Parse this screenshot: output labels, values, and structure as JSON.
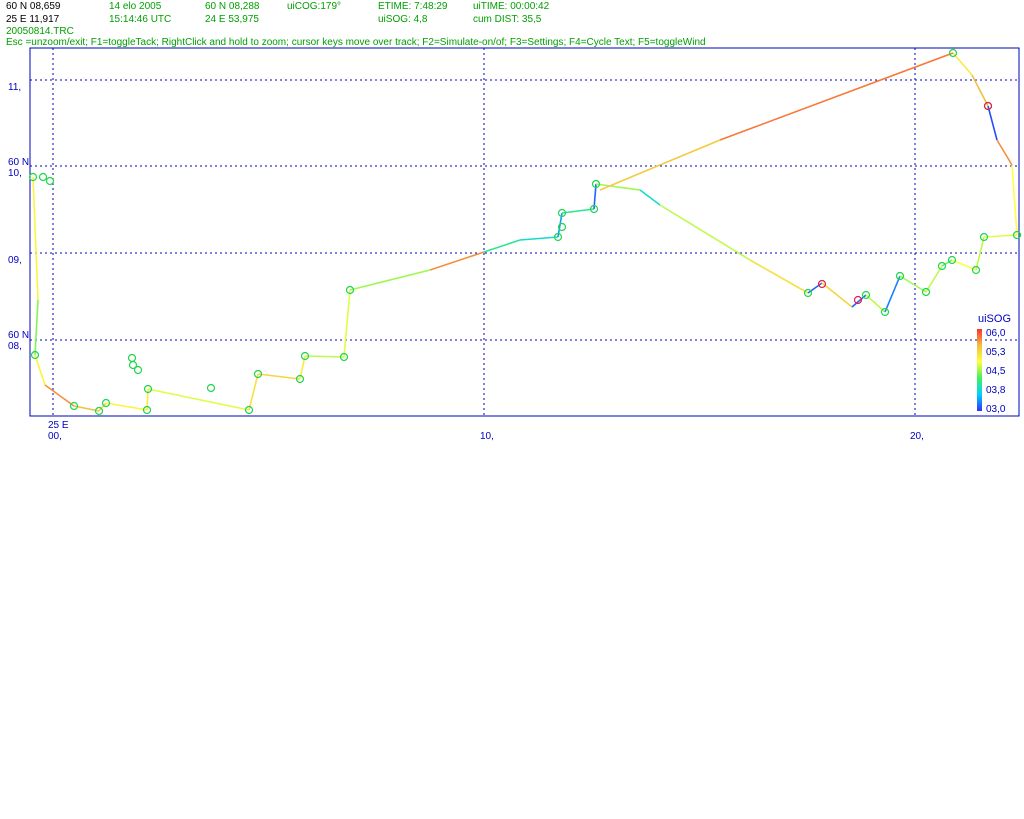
{
  "header": {
    "lat_cursor": "60 N 08,659",
    "lon_cursor": "25 E 11,917",
    "date": "14 elo 2005",
    "time_utc": "15:14:46 UTC",
    "lat_pos": "60 N 08,288",
    "lon_pos": "24 E 53,975",
    "cog": "uiCOG:179°",
    "etime": "ETIME: 7:48:29",
    "sog": "uiSOG: 4,8",
    "uitime": "uiTIME: 00:00:42",
    "cum_dist": "cum DIST: 35,5",
    "file_name": "20050814.TRC",
    "help": "Esc =unzoom/exit; F1=toggleTack; RightClick and hold to zoom; cursor keys move over track; F2=Simulate-on/of; F3=Settings; F4=Cycle Text; F5=toggleWind"
  },
  "axes": {
    "y_labels": [
      {
        "line1": "",
        "line2": "11,"
      },
      {
        "line1": "60 N",
        "line2": "10,"
      },
      {
        "line1": "",
        "line2": "09,"
      },
      {
        "line1": "60 N",
        "line2": "08,"
      }
    ],
    "x_labels": [
      {
        "line1": "25 E",
        "line2": "00,"
      },
      {
        "line1": "",
        "line2": "10,"
      },
      {
        "line1": "",
        "line2": "20,"
      }
    ]
  },
  "legend": {
    "title": "uiSOG",
    "ticks": [
      "06,0",
      "05,3",
      "04,5",
      "03,8",
      "03,0"
    ]
  },
  "colors": {
    "text_black": "#000000",
    "text_green": "#00a000",
    "text_blue": "#0000c0",
    "grid": "#0000c0",
    "marker": "#1fd64a",
    "marker_alt": "#e0204a"
  },
  "chart_data": {
    "type": "scatter",
    "title": "",
    "xlabel": "25 E",
    "ylabel": "60 N",
    "xlim": [
      24.95,
      25.22
    ],
    "ylim": [
      7.1,
      11.7
    ],
    "grid": true,
    "color_scale": {
      "name": "uiSOG",
      "range": [
        3.0,
        6.0
      ],
      "stops": [
        "#3030ff",
        "#00d0ff",
        "#40f060",
        "#ffff40",
        "#f0c040",
        "#ff3030"
      ]
    },
    "track": [
      {
        "x": 24.95,
        "y": 9.85,
        "sog": 4.9
      },
      {
        "x": 24.95,
        "y": 8.6,
        "sog": 4.4
      },
      {
        "x": 24.95,
        "y": 7.85,
        "sog": 4.9
      },
      {
        "x": 25.0,
        "y": 7.5,
        "sog": 5.6
      },
      {
        "x": 25.01,
        "y": 7.2,
        "sog": 5.4
      },
      {
        "x": 25.01,
        "y": 7.15,
        "sog": 5.2
      },
      {
        "x": 25.02,
        "y": 7.25,
        "sog": 4.9
      },
      {
        "x": 25.04,
        "y": 7.2,
        "sog": 5.0
      },
      {
        "x": 25.04,
        "y": 7.45,
        "sog": 4.7
      },
      {
        "x": 25.06,
        "y": 7.35,
        "sog": 5.1
      },
      {
        "x": 25.08,
        "y": 7.2,
        "sog": 5.0
      },
      {
        "x": 25.08,
        "y": 7.58,
        "sog": 4.6
      },
      {
        "x": 25.09,
        "y": 7.55,
        "sog": 4.4
      },
      {
        "x": 25.1,
        "y": 7.8,
        "sog": 4.3
      },
      {
        "x": 25.11,
        "y": 7.58,
        "sog": 4.8
      },
      {
        "x": 25.11,
        "y": 7.9,
        "sog": 4.5
      },
      {
        "x": 25.12,
        "y": 7.85,
        "sog": 4.6
      },
      {
        "x": 25.12,
        "y": 8.6,
        "sog": 4.4
      },
      {
        "x": 25.14,
        "y": 8.85,
        "sog": 5.6
      },
      {
        "x": 25.15,
        "y": 9.05,
        "sog": 5.2
      },
      {
        "x": 25.16,
        "y": 9.3,
        "sog": 3.5
      },
      {
        "x": 25.17,
        "y": 9.5,
        "sog": 4.5
      },
      {
        "x": 25.18,
        "y": 10.1,
        "sog": 5.0
      },
      {
        "x": 25.2,
        "y": 11.45,
        "sog": 5.2
      },
      {
        "x": 25.21,
        "y": 10.7,
        "sog": 4.1
      },
      {
        "x": 25.21,
        "y": 10.05,
        "sog": 5.7
      },
      {
        "x": 25.22,
        "y": 9.2,
        "sog": 4.7
      },
      {
        "x": 25.2,
        "y": 8.8,
        "sog": 4.6
      },
      {
        "x": 25.19,
        "y": 8.5,
        "sog": 4.4
      },
      {
        "x": 25.18,
        "y": 8.3,
        "sog": 3.2
      },
      {
        "x": 25.17,
        "y": 8.6,
        "sog": 4.8
      },
      {
        "x": 25.16,
        "y": 9.8,
        "sog": 4.0
      },
      {
        "x": 25.15,
        "y": 9.55,
        "sog": 3.6
      }
    ]
  }
}
